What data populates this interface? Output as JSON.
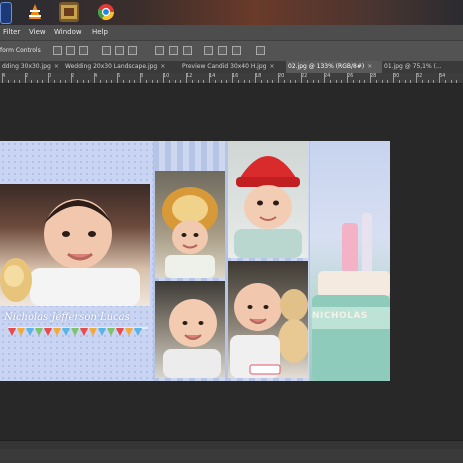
{
  "menu": {
    "filter": "Filter",
    "view": "View",
    "window": "Window",
    "help": "Help"
  },
  "options": {
    "transform_label": "form Controls"
  },
  "tabs": [
    {
      "label": "dding 30x30.jpg",
      "close": "×"
    },
    {
      "label": "Wedding 20x30 Landscape.jpg",
      "close": "×"
    },
    {
      "label": "Preview Candid 30x40 H.jpg",
      "close": "×"
    },
    {
      "label": "02.jpg @ 133% (RGB/8#)",
      "close": "×"
    },
    {
      "label": "01.jpg @ 75,1% (...",
      "close": ""
    }
  ],
  "ruler": {
    "labels": [
      "4",
      "2",
      "0",
      "2",
      "4",
      "6",
      "8",
      "10",
      "12",
      "14",
      "16",
      "18",
      "20",
      "22",
      "24",
      "26",
      "28",
      "30",
      "32",
      "34"
    ]
  },
  "document": {
    "caption": "Nicholas Jefferson Lucas",
    "cake_text": "NICHOLAS"
  },
  "colors": {
    "menubar": "#4d4d4d",
    "optbar": "#535353",
    "active_tab": "#5a5a5a",
    "canvas": "#282828"
  }
}
